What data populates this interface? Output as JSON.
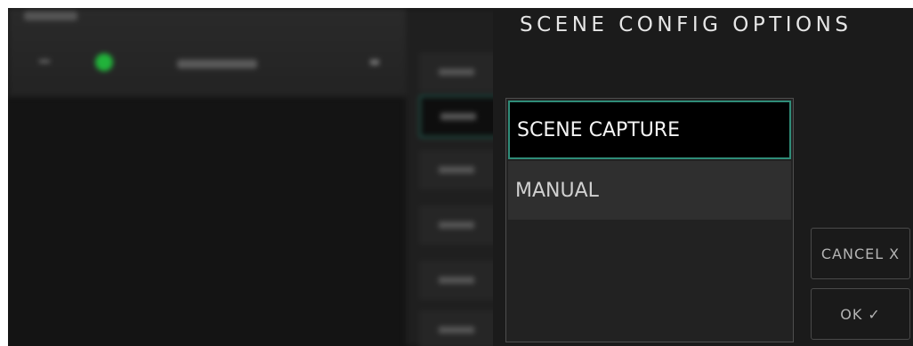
{
  "modal": {
    "title": "SCENE CONFIG OPTIONS",
    "options": [
      {
        "label": "SCENE CAPTURE",
        "selected": true
      },
      {
        "label": "MANUAL",
        "selected": false
      }
    ],
    "cancel_label": "CANCEL",
    "cancel_icon": "X",
    "ok_label": "OK",
    "ok_icon": "✓"
  },
  "colors": {
    "accent": "#2f8c78",
    "status_dot": "#21b33a",
    "modal_bg": "#1b1b1b"
  }
}
